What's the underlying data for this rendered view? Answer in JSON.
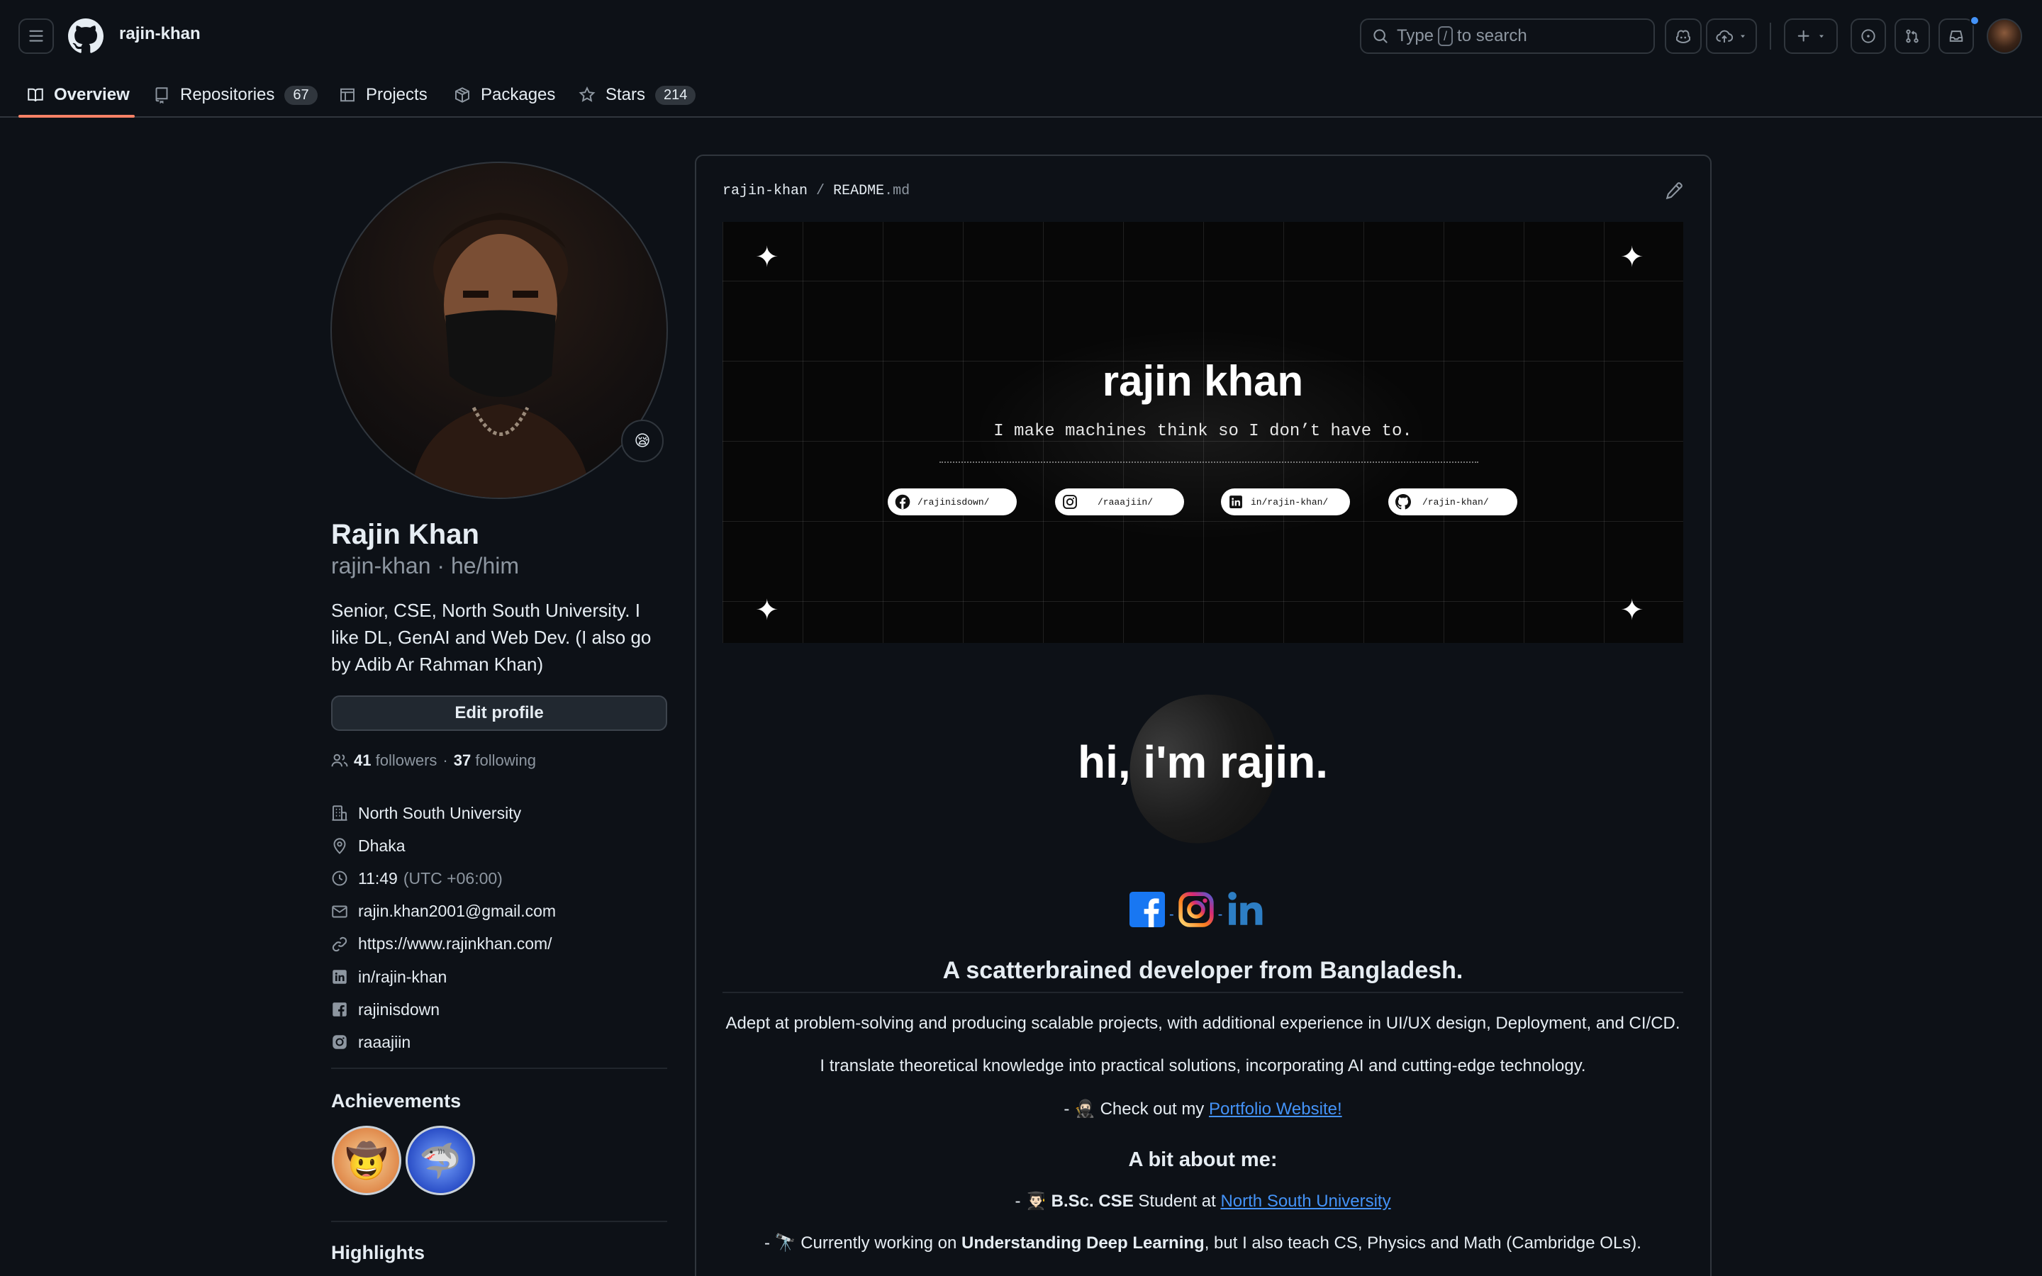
{
  "header": {
    "username": "rajin-khan",
    "search": {
      "prefix": "Type",
      "key": "/",
      "suffix": "to search"
    }
  },
  "tabs": [
    {
      "label": "Overview",
      "count": ""
    },
    {
      "label": "Repositories",
      "count": "67"
    },
    {
      "label": "Projects",
      "count": ""
    },
    {
      "label": "Packages",
      "count": ""
    },
    {
      "label": "Stars",
      "count": "214"
    }
  ],
  "profile": {
    "full_name": "Rajin Khan",
    "handle": "rajin-khan · he/him",
    "status_emoji": "😪",
    "bio": "Senior, CSE, North South University. I like DL, GenAI and Web Dev. (I also go by Adib Ar Rahman Khan)",
    "edit_label": "Edit profile",
    "followers": "41",
    "followers_label": "followers",
    "dot": "·",
    "following": "37",
    "following_label": "following",
    "organization": "North South University",
    "location": "Dhaka",
    "local_time": "11:49",
    "timezone": "(UTC +06:00)",
    "email": "rajin.khan2001@gmail.com",
    "website": "https://www.rajinkhan.com/",
    "linkedin": "in/rajin-khan",
    "facebook": "rajinisdown",
    "instagram": "raaajiin"
  },
  "achievements": {
    "title": "Achievements",
    "badges": [
      "🤠",
      "🦈"
    ]
  },
  "highlights_title": "Highlights",
  "readme": {
    "path_user": "rajin-khan",
    "path_sep": "/",
    "path_file": "README",
    "path_ext": ".md",
    "banner": {
      "title": "rajin khan",
      "subtitle": "I make machines think so I don’t have to.",
      "links": [
        "/rajinisdown/",
        "/raaajiin/",
        "in/rajin-khan/",
        "/rajin-khan/"
      ]
    },
    "greeting": "hi, i'm rajin.",
    "social_sep": "-",
    "headline": "A scatterbrained developer from Bangladesh.",
    "p1": "Adept at problem-solving and producing scalable projects, with additional experience in UI/UX design, Deployment, and CI/CD.",
    "p2": "I translate theoretical knowledge into practical solutions, incorporating AI and cutting-edge technology.",
    "p3_prefix": "- 🥷🏻 Check out my",
    "p3_link": "Portfolio Website!",
    "about_title": "A bit about me:",
    "p4_prefix": "- 👨🏻‍🎓",
    "p4_bold": "B.Sc. CSE",
    "p4_mid": "Student at",
    "p4_link": "North South University",
    "p5_prefix": "- 🔭 Currently working on",
    "p5_bold": "Understanding Deep Learning",
    "p5_suffix": ", but I also teach CS, Physics and Math (Cambridge OLs)."
  },
  "colors": {
    "bg": "#0d1117",
    "border": "#30363d",
    "text": "#e6edf3",
    "muted": "#8d96a0",
    "accent_link": "#4493f8",
    "active_tab": "#f78166"
  }
}
